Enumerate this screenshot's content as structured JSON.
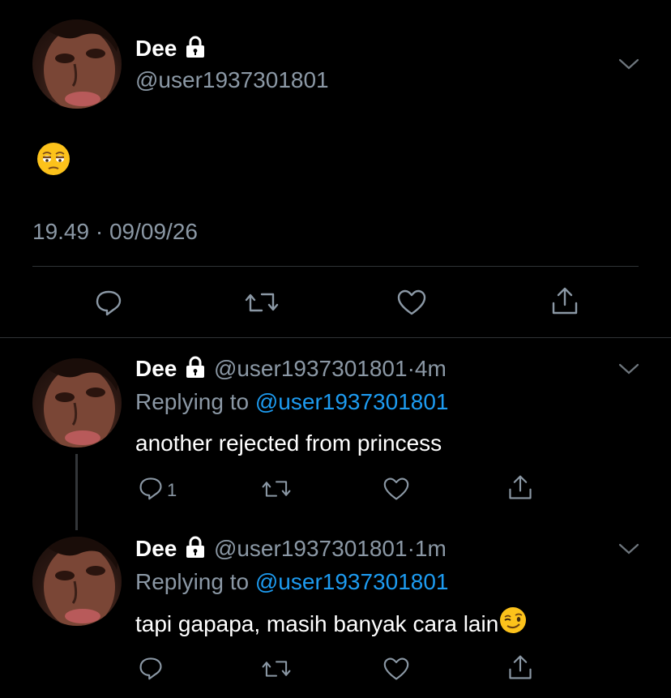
{
  "main_tweet": {
    "display_name": "Dee",
    "handle": "@user1937301801",
    "text_emoji": "pensive-face",
    "time": "19.49",
    "date": "09/09/26",
    "dot": "·"
  },
  "replies": [
    {
      "display_name": "Dee",
      "handle": "@user1937301801",
      "dot": "·",
      "age": "4m",
      "replying_prefix": "Replying to",
      "replying_handle": "@user1937301801",
      "text": "another rejected from princess",
      "reply_count": "1"
    },
    {
      "display_name": "Dee",
      "handle": "@user1937301801",
      "dot": "·",
      "age": "1m",
      "replying_prefix": "Replying to",
      "replying_handle": "@user1937301801",
      "text": "tapi gapapa, masih banyak cara lain",
      "trailing_emoji": "winking-face"
    }
  ],
  "colors": {
    "background": "#000000",
    "secondary_text": "#8b98a5",
    "link": "#1d9bf0",
    "divider": "#2f3336"
  }
}
